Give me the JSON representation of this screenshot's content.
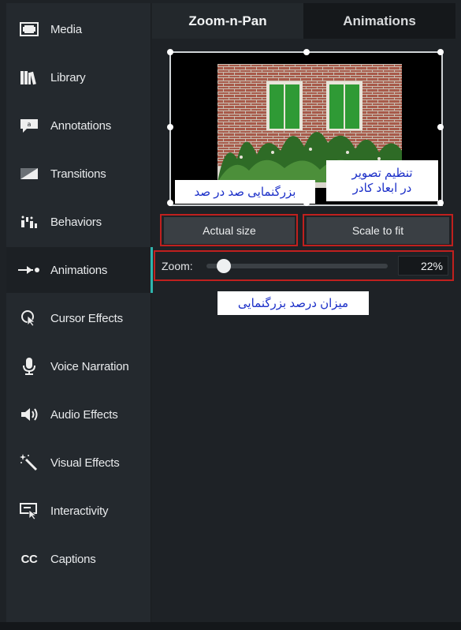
{
  "sidebar": {
    "items": [
      {
        "label": "Media",
        "icon": "film-icon"
      },
      {
        "label": "Library",
        "icon": "library-icon"
      },
      {
        "label": "Annotations",
        "icon": "annotation-icon"
      },
      {
        "label": "Transitions",
        "icon": "transition-icon"
      },
      {
        "label": "Behaviors",
        "icon": "behaviors-icon"
      },
      {
        "label": "Animations",
        "icon": "animation-arrow-icon",
        "active": true
      },
      {
        "label": "Cursor Effects",
        "icon": "cursor-effects-icon"
      },
      {
        "label": "Voice Narration",
        "icon": "microphone-icon"
      },
      {
        "label": "Audio Effects",
        "icon": "speaker-icon"
      },
      {
        "label": "Visual Effects",
        "icon": "magic-wand-icon"
      },
      {
        "label": "Interactivity",
        "icon": "interactivity-icon"
      },
      {
        "label": "Captions",
        "icon": "captions-icon",
        "glyph": "CC"
      }
    ]
  },
  "tabs": [
    {
      "label": "Zoom-n-Pan",
      "active": true
    },
    {
      "label": "Animations",
      "active": false
    }
  ],
  "buttons": {
    "actual_size": "Actual size",
    "scale_to_fit": "Scale to fit"
  },
  "zoom": {
    "label": "Zoom:",
    "value": "22%",
    "fraction": 0.06
  },
  "notes": {
    "scale_fit_line1": "تنظیم تصویر",
    "scale_fit_line2": "در ابعاد کادر",
    "actual_size": "بزرگنمایی صد در صد",
    "zoom_percent": "میزان درصد بزرگنمایی"
  },
  "colors": {
    "accent": "#2fb5ad",
    "highlight_border": "#c0201e",
    "note_text": "#1a2ec8"
  }
}
